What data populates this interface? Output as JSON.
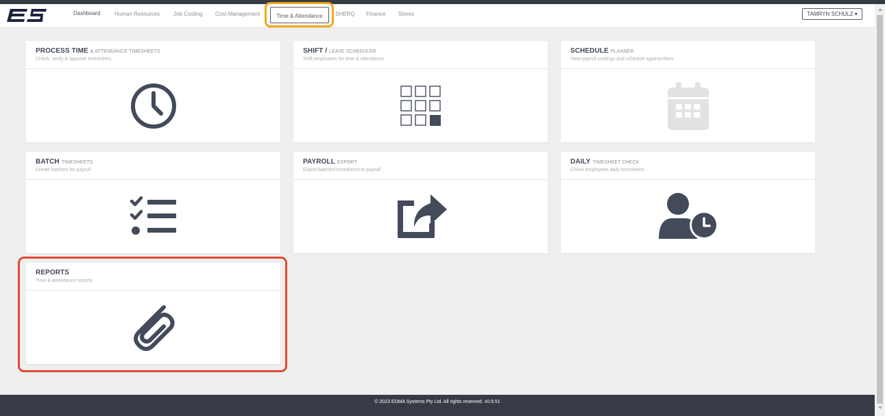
{
  "header": {
    "logo_text": "ES",
    "nav": [
      {
        "label": "Dashboard"
      },
      {
        "label": "Human Resources"
      },
      {
        "label": "Job Costing"
      },
      {
        "label": "Cost Management"
      },
      {
        "label": "Time & Attendance",
        "active": true
      },
      {
        "label": "SHERQ"
      },
      {
        "label": "Finance"
      },
      {
        "label": "Stores"
      }
    ],
    "user_label": "TAMRYN SCHULZ ▾"
  },
  "cards": [
    {
      "title": "PROCESS TIME",
      "subtitle": "& ATTENDANCE TIMESHEETS",
      "description": "Check, verify & approve timesheets",
      "icon": "clock-icon"
    },
    {
      "title": "SHIFT /",
      "subtitle": "LEAVE SCHEDULER",
      "description": "Shift employees for time & attendance",
      "icon": "grid-icon"
    },
    {
      "title": "SCHEDULE",
      "subtitle": "PLANNER",
      "description": "View payroll costings and schedule against them",
      "icon": "calendar-icon"
    },
    {
      "title": "BATCH",
      "subtitle": "TIMESHEETS",
      "description": "Create batches for payroll",
      "icon": "checklist-icon"
    },
    {
      "title": "PAYROLL",
      "subtitle": "EXPORT",
      "description": "Export batched timesheets to payroll",
      "icon": "share-icon"
    },
    {
      "title": "DAILY",
      "subtitle": "TIMESHEET CHECK",
      "description": "Check employees daily timesheets",
      "icon": "user-clock-icon"
    },
    {
      "title": "REPORTS",
      "subtitle": "",
      "description": "Time & Attendance reports",
      "icon": "paperclip-icon"
    }
  ],
  "footer": {
    "text": "© 2023 EDMA Systems Pty Ltd. All rights reserved. v0.9.51"
  },
  "colors": {
    "icon": "#434a5a",
    "icon_light": "#e2e2e2",
    "active_ring": "#f5a51b",
    "highlight": "#e04a32",
    "footer_bg": "#363b45"
  }
}
